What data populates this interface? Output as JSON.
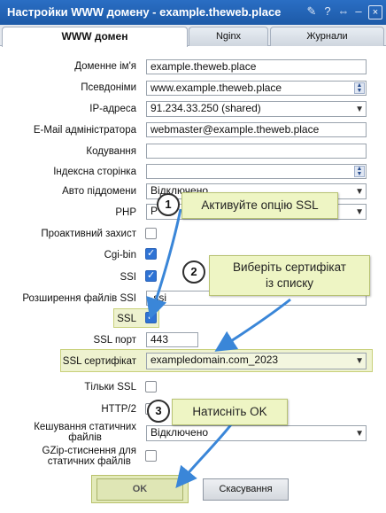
{
  "window": {
    "title": "Настройки WWW домену - example.theweb.place",
    "close_glyph": "×"
  },
  "tabs": [
    {
      "label": "WWW домен",
      "active": true
    },
    {
      "label": "Nginx",
      "active": false
    },
    {
      "label": "Журнали",
      "active": false
    }
  ],
  "form": {
    "domain_name": {
      "label": "Доменне ім'я",
      "value": "example.theweb.place"
    },
    "aliases": {
      "label": "Псевдоніми",
      "value": "www.example.theweb.place"
    },
    "ip": {
      "label": "IP-адреса",
      "value": "91.234.33.250 (shared)"
    },
    "admin_email": {
      "label": "E-Mail адміністратора",
      "value": "webmaster@example.theweb.place"
    },
    "encoding": {
      "label": "Кодування",
      "value": ""
    },
    "index_page": {
      "label": "Індексна сторінка",
      "value": ""
    },
    "auto_subdomains": {
      "label": "Авто піддомени",
      "value": "Відключено"
    },
    "php": {
      "label": "PHP",
      "value": "P"
    },
    "proactive": {
      "label": "Проактивний захист",
      "checked": false
    },
    "cgi": {
      "label": "Cgi-bin",
      "checked": true
    },
    "ssi": {
      "label": "SSI",
      "checked": true
    },
    "ssi_ext": {
      "label": "Розширення файлів SSI",
      "value": ".ssi"
    },
    "ssl": {
      "label": "SSL",
      "checked": true
    },
    "ssl_port": {
      "label": "SSL порт",
      "value": "443"
    },
    "ssl_cert": {
      "label": "SSL сертифікат",
      "value": "exampledomain.com_2023"
    },
    "ssl_only": {
      "label": "Тільки SSL",
      "checked": false
    },
    "http2": {
      "label": "HTTP/2",
      "checked": false
    },
    "static_cache": {
      "label_line1": "Кешування статичних",
      "label_line2": "файлів",
      "value": "Відключено"
    },
    "gzip_static": {
      "label_line1": "GZip-стиснення для",
      "label_line2": "статичних файлів",
      "checked": false
    }
  },
  "buttons": {
    "ok": "OK",
    "cancel": "Скасування"
  },
  "callouts": [
    {
      "number": "1",
      "text": "Активуйте опцію SSL"
    },
    {
      "number": "2",
      "line1": "Виберіть сертифікат",
      "line2": "із списку"
    },
    {
      "number": "3",
      "text": "Натисніть OK"
    }
  ],
  "colors": {
    "titlebar": "#1d5aa8",
    "callout": "#eef5c4",
    "arrow": "#3a86d8",
    "highlight": "#eef2cf"
  }
}
